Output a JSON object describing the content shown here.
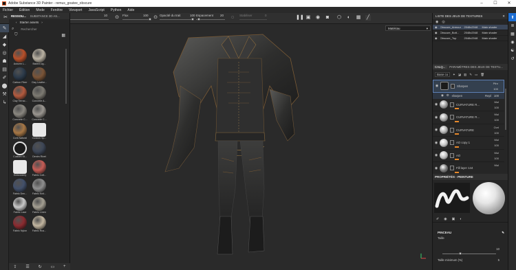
{
  "window": {
    "title": "Adobe Substance 3D Painter - remus_goatee_obscure",
    "controls": [
      "–",
      "☐",
      "✕"
    ]
  },
  "menu": [
    "Fichier",
    "Édition",
    "Mode",
    "Fenêtre",
    "Viewport",
    "JavaScript",
    "Python",
    "Aide"
  ],
  "toolbar": {
    "size_label": "Taille",
    "size_value": "10",
    "flux_label": "Flux",
    "flux_value": "100",
    "opacity_label": "Opacité du trait",
    "opacity_value": "100",
    "spacing_label": "Espacement",
    "spacing_value": "20",
    "stabilizer_label": "Stabiliser",
    "stabilizer_value": "0"
  },
  "assets": {
    "tabs": [
      "RESSOU...",
      "SUBSTANCE 3D AS..."
    ],
    "breadcrumb": "Starter assets",
    "search_placeholder": "Rechercher",
    "items": [
      {
        "label": "Autumn L...",
        "color": "#b8502a",
        "kind": "leaf"
      },
      {
        "label": "Baked Lig...",
        "color": "#b9b1a2",
        "kind": "ball"
      },
      {
        "label": "Carbon Fiber",
        "color": "#2c3a4a",
        "kind": "ball"
      },
      {
        "label": "Clay Leathe...",
        "color": "#7a5437",
        "kind": "ball"
      },
      {
        "label": "Clay Terrac...",
        "color": "#b35a3e",
        "kind": "ball"
      },
      {
        "label": "Concrete A...",
        "color": "#7d7a72",
        "kind": "ball"
      },
      {
        "label": "Concrete C...",
        "color": "#8a8780",
        "kind": "ball"
      },
      {
        "label": "Concrete C...",
        "color": "#9a9690",
        "kind": "ball"
      },
      {
        "label": "Cork Natural",
        "color": "#a77745",
        "kind": "ball"
      },
      {
        "label": "Custom Sp...",
        "color": "#eeeeee",
        "kind": "brush"
      },
      {
        "label": "Custom St...",
        "color": "#1e1e1e",
        "kind": "ring"
      },
      {
        "label": "Denim Rivet",
        "color": "#3d4656",
        "kind": "ball"
      },
      {
        "label": "Embroidery",
        "color": "#e5e5e5",
        "kind": "brush"
      },
      {
        "label": "Fabric Cott...",
        "color": "#c65c55",
        "kind": "ball"
      },
      {
        "label": "Fabric Den...",
        "color": "#42506a",
        "kind": "ball"
      },
      {
        "label": "Fabric Knit...",
        "color": "#8f8f8f",
        "kind": "ball"
      },
      {
        "label": "Fabric Lace",
        "color": "#c8c8c8",
        "kind": "ball"
      },
      {
        "label": "Fabric Linen",
        "color": "#a49f92",
        "kind": "ball"
      },
      {
        "label": "Fabric Nylon",
        "color": "#8b2b30",
        "kind": "ball"
      },
      {
        "label": "Fabric Rus...",
        "color": "#c2b6a0",
        "kind": "ball"
      }
    ]
  },
  "viewport": {
    "material_select": "Matériau"
  },
  "texture_sets": {
    "tab": "LISTE DES JEUX DE TEXTURES",
    "rows": [
      {
        "name": "Obscure_Armour",
        "res": "2048x2048",
        "shader": "Main shader",
        "selected": true
      },
      {
        "name": "Obscure_Bott...",
        "res": "2048x2048",
        "shader": "Main shader",
        "selected": false
      },
      {
        "name": "Obscure_Top",
        "res": "2048x2048",
        "shader": "Main shader",
        "selected": false
      }
    ]
  },
  "layers_panel": {
    "tabs": [
      "CALQ...",
      "PARAMÈTRES DES JEUX DE TEXTU..."
    ],
    "base_select": "Base co",
    "layers": [
      {
        "name": "Sharpen",
        "blend": "Pthr",
        "opacity": "100",
        "thumb": "#2a2a2a",
        "selected": true
      },
      {
        "name": "CURVATURE R...",
        "blend": "Mul",
        "opacity": "100",
        "thumb": "#9a9a9a",
        "selected": false
      },
      {
        "name": "CURVATURE R...",
        "blend": "Mul",
        "opacity": "100",
        "thumb": "#a5a5a5",
        "selected": false
      },
      {
        "name": "CURVATURE",
        "blend": "Ovrl",
        "opacity": "100",
        "thumb": "#b0b0b0",
        "selected": false
      },
      {
        "name": "AO copy 1",
        "blend": "Mul",
        "opacity": "100",
        "thumb": "#c5c5c5",
        "selected": false
      },
      {
        "name": "AO",
        "blend": "Mul",
        "opacity": "100",
        "thumb": "#bdbdbd",
        "selected": false
      },
      {
        "name": "Fill layer 144",
        "blend": "Mul",
        "opacity": "",
        "thumb": "#777777",
        "selected": false
      }
    ],
    "sublayer": {
      "name": "sharpen",
      "blend": "Repl",
      "opacity": "100"
    }
  },
  "properties": {
    "title": "PROPRIÉTÉS - PEINTURE",
    "section": "PINCEAU",
    "size_label": "Taille",
    "size_value": "10",
    "min_size_label": "Taille minimum (%)",
    "min_size_value": "5"
  }
}
